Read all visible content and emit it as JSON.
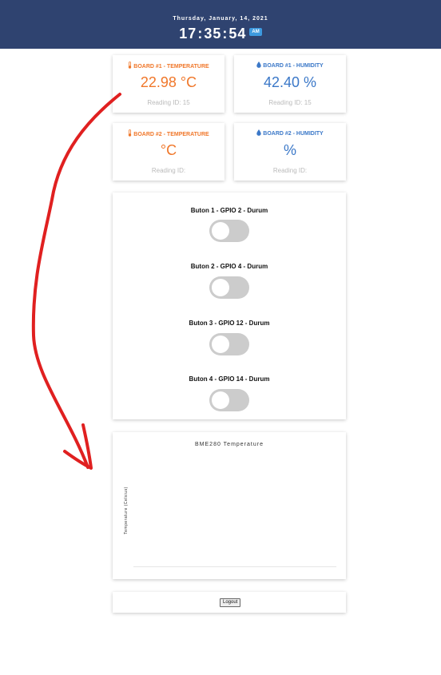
{
  "header": {
    "date": "Thursday, January, 14, 2021",
    "hours": "17",
    "minutes": "35",
    "seconds": "54",
    "separator": ":",
    "ampm": "AM"
  },
  "readings": [
    {
      "title": "BOARD #1 - TEMPERATURE",
      "value": "22.98 °C",
      "reading_id": "Reading ID: 15",
      "icon": "thermometer-icon",
      "color": "#f0772a"
    },
    {
      "title": "BOARD #1 - HUMIDITY",
      "value": "42.40 %",
      "reading_id": "Reading ID: 15",
      "icon": "droplet-icon",
      "color": "#3b78c8"
    },
    {
      "title": "BOARD #2 - TEMPERATURE",
      "value": "°C",
      "reading_id": "Reading ID:",
      "icon": "thermometer-icon",
      "color": "#f0772a"
    },
    {
      "title": "BOARD #2 - HUMIDITY",
      "value": "%",
      "reading_id": "Reading ID:",
      "icon": "droplet-icon",
      "color": "#3b78c8"
    }
  ],
  "switches": [
    {
      "label": "Buton 1 - GPIO 2 - Durum",
      "on": false
    },
    {
      "label": "Buton 2 - GPIO 4 - Durum",
      "on": false
    },
    {
      "label": "Buton 3 - GPIO 12 - Durum",
      "on": false
    },
    {
      "label": "Buton 4 - GPIO 14 - Durum",
      "on": false
    }
  ],
  "chart": {
    "title": "BME280 Temperature",
    "ylabel": "Temperature (Celsius)"
  },
  "chart_data": {
    "type": "line",
    "title": "BME280 Temperature",
    "xlabel": "",
    "ylabel": "Temperature (Celsius)",
    "series": [],
    "grid": false
  },
  "logout": {
    "label": "Logout"
  },
  "annotation": {
    "color": "#e02020"
  }
}
